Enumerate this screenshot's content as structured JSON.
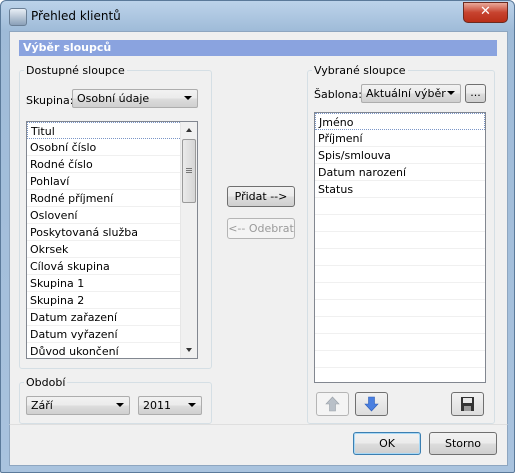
{
  "window": {
    "title": "Přehled klientů",
    "close_label": "✕"
  },
  "section_header": "Výběr sloupců",
  "available": {
    "group_label": "Dostupné sloupce",
    "group_field_label": "Skupina:",
    "group_value": "Osobní údaje",
    "items": [
      "Titul",
      "Osobní číslo",
      "Rodné číslo",
      "Pohlaví",
      "Rodné příjmení",
      "Oslovení",
      "Poskytovaná služba",
      "Okrsek",
      "Cílová skupina",
      "Skupina 1",
      "Skupina 2",
      "Datum zařazení",
      "Datum vyřazení",
      "Důvod ukončení"
    ]
  },
  "period": {
    "group_label": "Období",
    "month": "Září",
    "year": "2011"
  },
  "actions": {
    "add": "Přidat -->",
    "remove": "<-- Odebrat"
  },
  "selected": {
    "group_label": "Vybrané sloupce",
    "template_label": "Šablona:",
    "template_value": "Aktuální výběr",
    "browse_label": "...",
    "items": [
      "Jméno",
      "Příjmení",
      "Spis/smlouva",
      "Datum narození",
      "Status"
    ]
  },
  "footer": {
    "ok": "OK",
    "cancel": "Storno"
  },
  "icons": {
    "up": "arrow-up-icon",
    "down": "arrow-down-icon",
    "save": "floppy-disk-icon"
  },
  "colors": {
    "header_bar": "#8aa3df",
    "arrow_up": "#b9c0c8",
    "arrow_down": "#4a7fe0"
  }
}
